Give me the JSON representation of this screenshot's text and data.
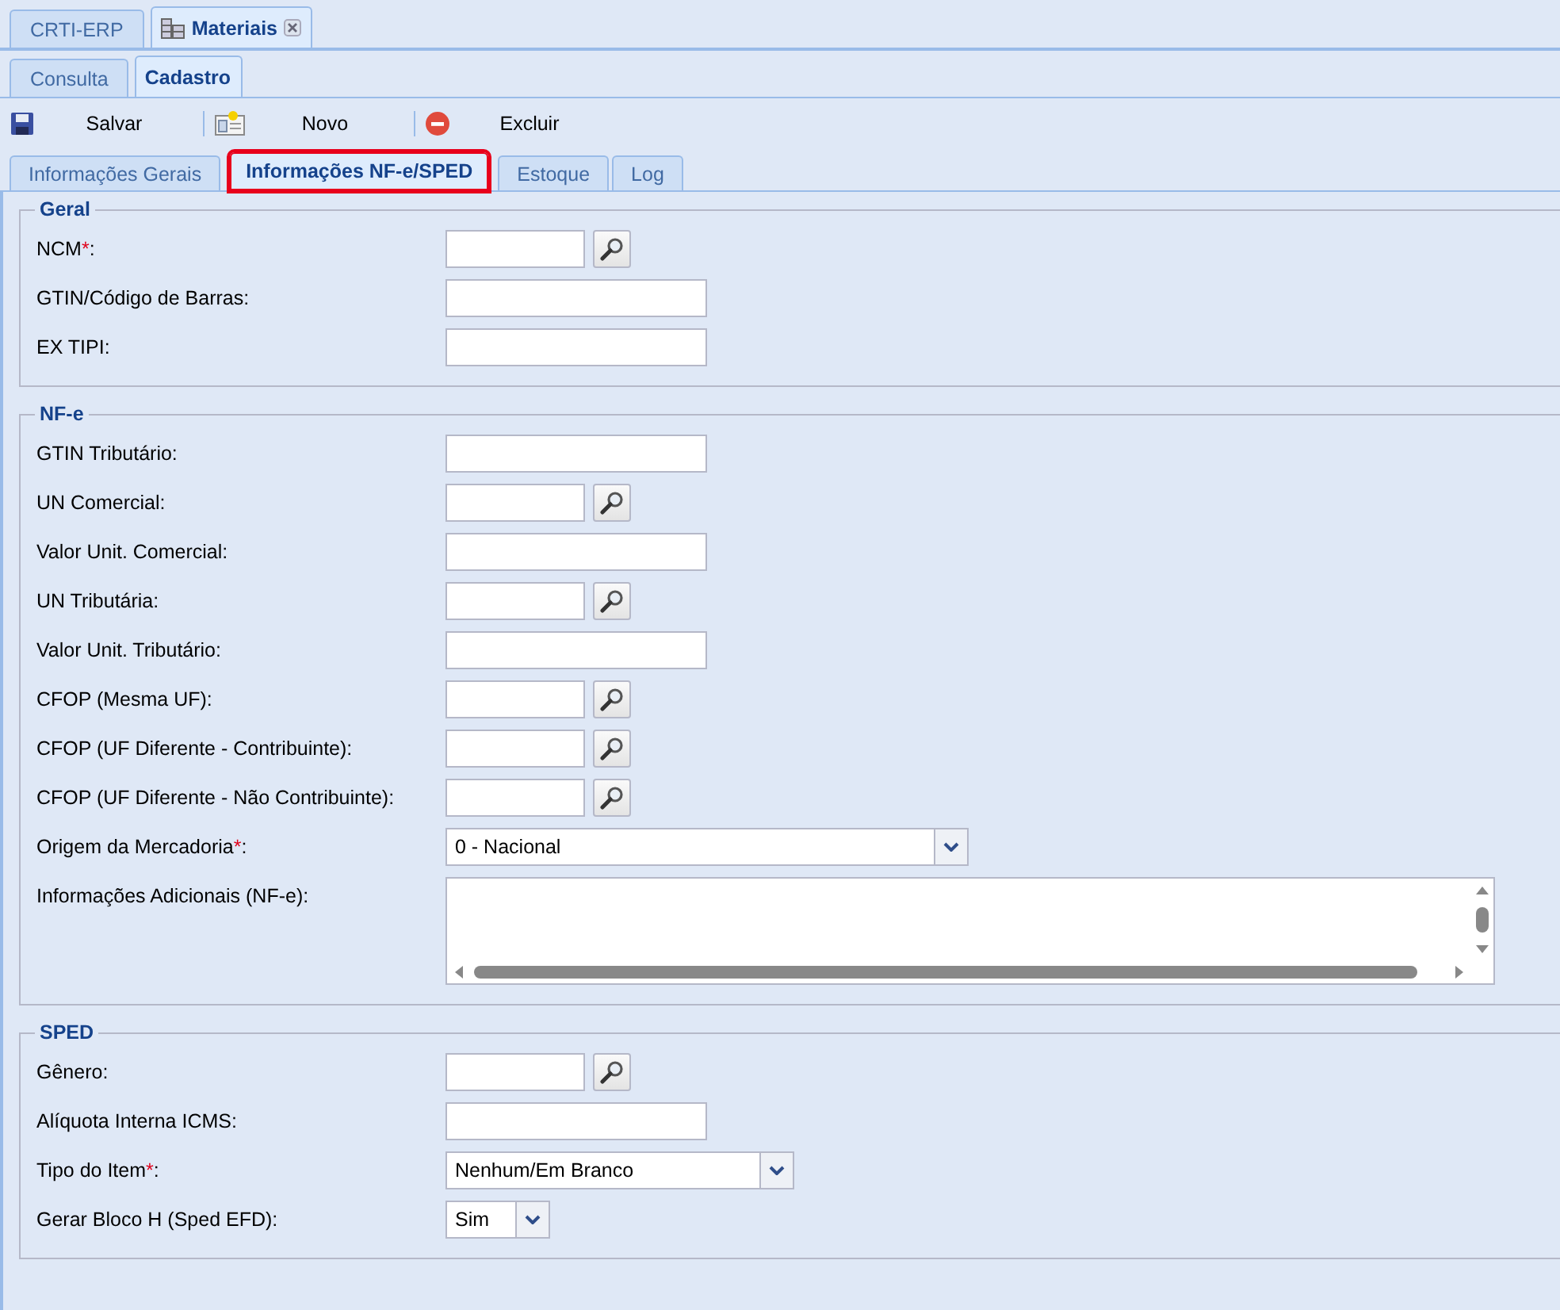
{
  "app_tabs": [
    {
      "label": "CRTI-ERP",
      "selected": false,
      "kind": "home"
    },
    {
      "label": "Materiais",
      "selected": true,
      "kind": "module"
    }
  ],
  "mode_tabs": [
    {
      "label": "Consulta",
      "selected": false
    },
    {
      "label": "Cadastro",
      "selected": true
    }
  ],
  "toolbar": [
    {
      "label": "Salvar"
    },
    {
      "label": "Novo"
    },
    {
      "label": "Excluir"
    }
  ],
  "form_tabs": [
    {
      "label": "Informações Gerais",
      "selected": false,
      "highlighted": false
    },
    {
      "label": "Informações NF-e/SPED",
      "selected": true,
      "highlighted": true
    },
    {
      "label": "Estoque",
      "selected": false,
      "highlighted": false
    },
    {
      "label": "Log",
      "selected": false,
      "highlighted": false
    }
  ],
  "sections": [
    {
      "title": "Geral",
      "fields": [
        {
          "label": "NCM",
          "required": "*",
          "end": ":",
          "kind": "lookup"
        },
        {
          "label": "GTIN/Código de Barras:",
          "kind": "text"
        },
        {
          "label": "EX TIPI:",
          "kind": "text"
        }
      ]
    },
    {
      "title": "NF-e",
      "fields": [
        {
          "label": "GTIN Tributário:",
          "kind": "text"
        },
        {
          "label": "UN Comercial:",
          "kind": "lookup"
        },
        {
          "label": "Valor Unit. Comercial:",
          "kind": "text"
        },
        {
          "label": "UN Tributária:",
          "kind": "lookup"
        },
        {
          "label": "Valor Unit. Tributário:",
          "kind": "text"
        },
        {
          "label": "CFOP (Mesma UF):",
          "kind": "lookup"
        },
        {
          "label": "CFOP (UF Diferente - Contribuinte):",
          "kind": "lookup"
        },
        {
          "label": "CFOP (UF Diferente - Não Contribuinte):",
          "kind": "lookup"
        },
        {
          "label": "Origem da Mercadoria",
          "required": "*",
          "end": ":",
          "kind": "combo",
          "value": "0 - Nacional"
        },
        {
          "label": "Informações Adicionais (NF-e):",
          "kind": "textarea"
        }
      ]
    },
    {
      "title": "SPED",
      "fields": [
        {
          "label": "Gênero:",
          "kind": "lookup"
        },
        {
          "label": "Alíquota Interna ICMS:",
          "kind": "text"
        },
        {
          "label": "Tipo do Item",
          "required": "*",
          "end": ":",
          "kind": "combo",
          "value": "Nenhum/Em Branco"
        },
        {
          "label": "Gerar Bloco H (Sped EFD):",
          "kind": "combo",
          "value": "Sim"
        }
      ]
    }
  ]
}
